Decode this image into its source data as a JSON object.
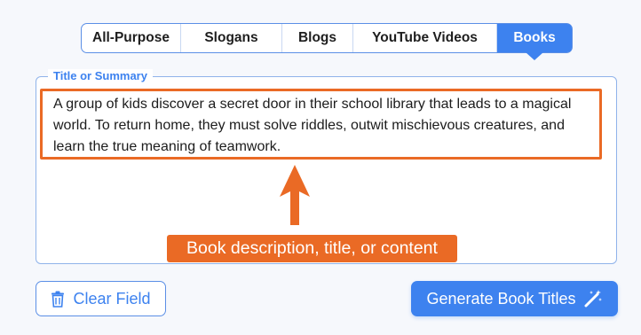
{
  "tabs": [
    {
      "label": "All-Purpose",
      "active": false
    },
    {
      "label": "Slogans",
      "active": false
    },
    {
      "label": "Blogs",
      "active": false
    },
    {
      "label": "YouTube Videos",
      "active": false
    },
    {
      "label": "Books",
      "active": true
    }
  ],
  "field": {
    "legend": "Title or Summary",
    "value": "A group of kids discover a secret door in their school library that leads to a magical world. To return home, they must solve riddles, outwit mischievous creatures, and learn the true meaning of teamwork."
  },
  "annotation": {
    "text": "Book description, title, or content"
  },
  "buttons": {
    "clear_label": "Clear Field",
    "generate_label": "Generate Book Titles"
  },
  "icons": {
    "clear": "trash-icon",
    "generate": "magic-wand-icon",
    "annotation": "arrow-up-icon"
  },
  "colors": {
    "accent": "#3d82ef",
    "highlight": "#ea6a25"
  }
}
